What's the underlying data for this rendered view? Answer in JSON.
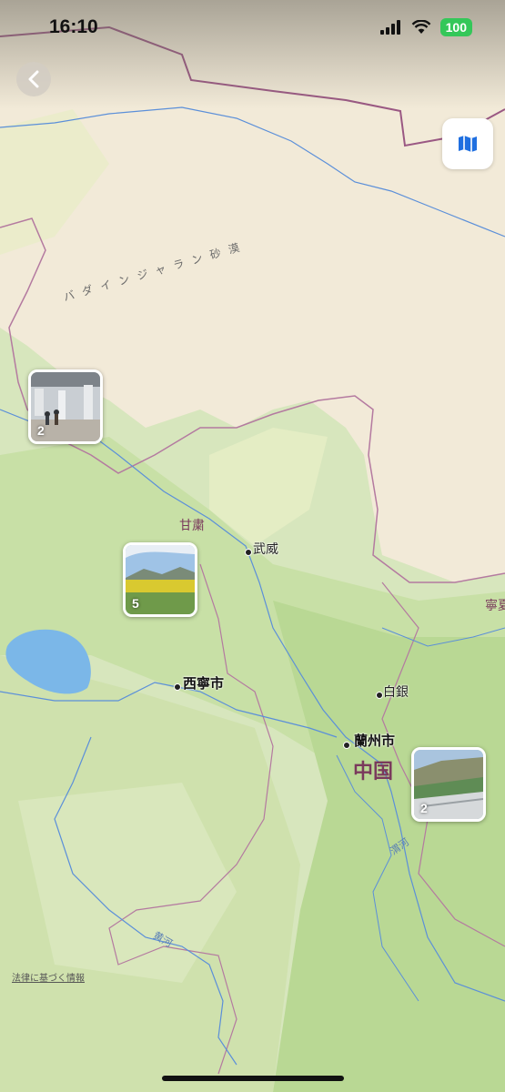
{
  "status_bar": {
    "time": "16:10",
    "battery": "100",
    "icons": [
      "cellular-signal-icon",
      "wifi-icon",
      "battery-icon"
    ]
  },
  "nav": {
    "back_icon": "chevron-left-icon",
    "map_mode_icon": "map-icon"
  },
  "map": {
    "desert_label": "バダインジャラン砂漠",
    "province_labels": [
      "甘粛",
      "寧夏"
    ],
    "country_label": "中国",
    "cities": [
      "武威",
      "白銀",
      "西寧市",
      "蘭州市"
    ],
    "rivers": [
      "渭河",
      "黄河"
    ],
    "legal_link": "法律に基づく情報"
  },
  "photo_clusters": [
    {
      "count": "2"
    },
    {
      "count": "5"
    },
    {
      "count": "2"
    }
  ],
  "colors": {
    "accent": "#1f6fe0",
    "border": "#8b4a6b",
    "river": "#5b8fd9",
    "lake": "#7bb7e8",
    "battery": "#34c759"
  }
}
